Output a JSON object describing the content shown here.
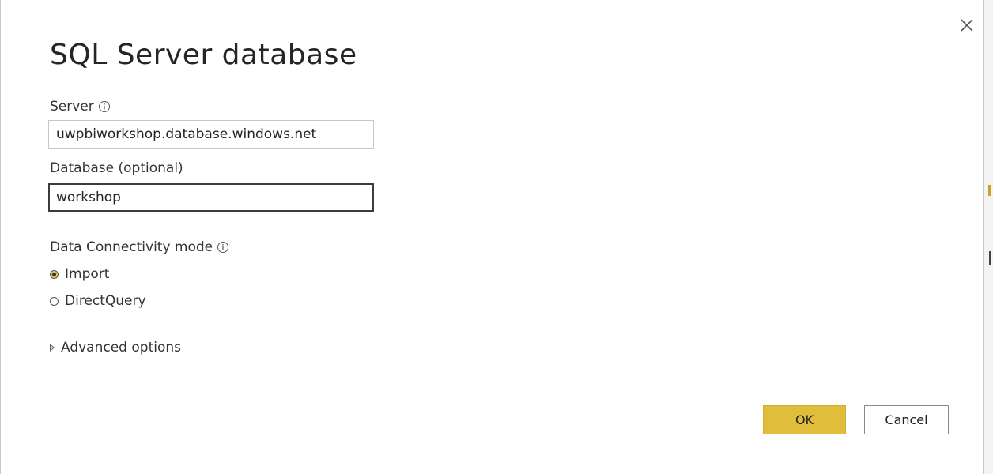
{
  "dialog": {
    "title": "SQL Server database",
    "close_icon": "close-icon"
  },
  "server": {
    "label": "Server",
    "value": "uwpbiworkshop.database.windows.net",
    "info_icon": "info-icon"
  },
  "database": {
    "label": "Database (optional)",
    "value": "workshop"
  },
  "connectivity": {
    "label": "Data Connectivity mode",
    "info_icon": "info-icon",
    "options": [
      {
        "label": "Import",
        "selected": true
      },
      {
        "label": "DirectQuery",
        "selected": false
      }
    ]
  },
  "advanced": {
    "label": "Advanced options",
    "icon": "triangle-right-icon"
  },
  "buttons": {
    "ok_label": "OK",
    "cancel_label": "Cancel"
  },
  "colors": {
    "accent": "#e0bd3a",
    "text": "#252525"
  }
}
